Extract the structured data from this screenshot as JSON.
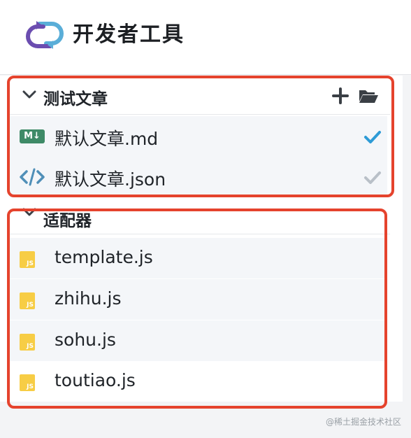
{
  "app": {
    "title": "开发者工具",
    "logo_icon": "sync-loop-logo"
  },
  "sections": [
    {
      "title": "测试文章",
      "actions": [
        {
          "icon": "plus-icon"
        },
        {
          "icon": "folder-open-icon"
        }
      ],
      "items": [
        {
          "label": "默认文章.md",
          "icon": "markdown-icon",
          "icon_text": "M↓",
          "status": "checked-active"
        },
        {
          "label": "默认文章.json",
          "icon": "code-icon",
          "status": "checked-inactive"
        }
      ]
    },
    {
      "title": "适配器",
      "items": [
        {
          "label": "template.js",
          "icon": "js-file-icon",
          "icon_text": "JS"
        },
        {
          "label": "zhihu.js",
          "icon": "js-file-icon",
          "icon_text": "JS"
        },
        {
          "label": "sohu.js",
          "icon": "js-file-icon",
          "icon_text": "JS"
        },
        {
          "label": "toutiao.js",
          "icon": "js-file-icon",
          "icon_text": "JS"
        }
      ]
    }
  ],
  "watermark": "@稀土掘金技术社区",
  "colors": {
    "highlight": "#e5432d",
    "check_active": "#2e9bd6",
    "check_inactive": "#b9c0c8",
    "js": "#f7cd45",
    "markdown": "#3e8a67"
  }
}
